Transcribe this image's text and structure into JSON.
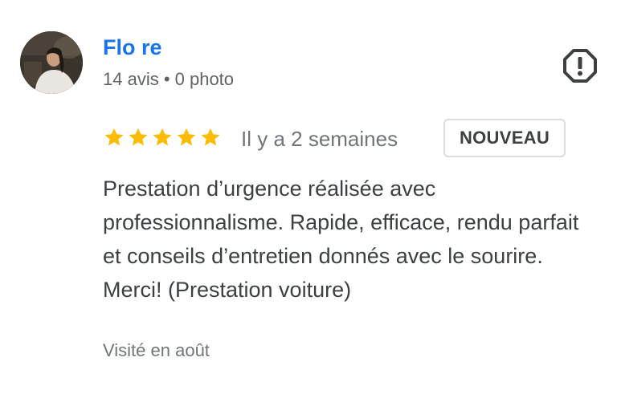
{
  "review": {
    "author": {
      "name": "Flo re",
      "meta": "14 avis • 0 photo",
      "avatar_icon": "profile-photo"
    },
    "report_icon": "report-flag-octagon-icon",
    "rating": 5,
    "rating_max": 5,
    "star_color": "#fbbc04",
    "date": "Il y a 2 semaines",
    "badge": "NOUVEAU",
    "text": "Prestation d’urgence réalisée avec professionnalisme. Rapide, efficace, rendu parfait et conseils d’entretien donnés avec le sourire. Merci! (Prestation voiture)",
    "visit": "Visité en août"
  },
  "colors": {
    "name": "#1a73e8",
    "meta": "#5f6368",
    "body": "#3c4043",
    "muted": "#70757a"
  }
}
